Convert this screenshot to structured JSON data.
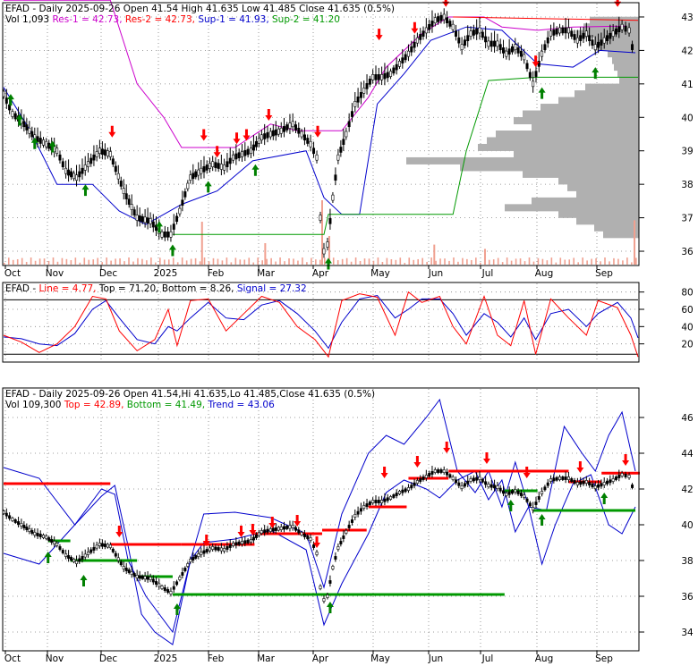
{
  "symbol": "EFAD",
  "colors": {
    "background": "#ffffff",
    "frame": "#000000",
    "grid": "#808080",
    "candle": "#000000",
    "up_arrow": "#008000",
    "down_arrow": "#ff0000",
    "volume": "#f0a090",
    "resistance": "#cc00cc",
    "support": "#0000cc",
    "support2": "#009900",
    "res_line": "#ff0000",
    "volume_profile": "#b0b0b0",
    "stoch_line": "#ff0000",
    "stoch_signal": "#0000cc",
    "bounds": "#000000",
    "trend_top": "#ff0000",
    "trend_bottom": "#009900",
    "envelope": "#0000cc"
  },
  "chart_data": [
    {
      "type": "candlestick",
      "panel": "price-sr",
      "title_parts": [
        {
          "text": "EFAD - Daily 2025-09-26 Open 41.54  High 41.635  Low 41.485  Close 41.635 (0.5%)",
          "color": "#000000"
        }
      ],
      "legend_parts": [
        {
          "text": "Vol 1,093 ",
          "color": "#000000"
        },
        {
          "text": "Res-1 = 42.73, ",
          "color": "#cc00cc"
        },
        {
          "text": "Res-2 = 42.73, ",
          "color": "#ff0000"
        },
        {
          "text": "Sup-1 = 41.93, ",
          "color": "#0000cc"
        },
        {
          "text": "Sup-2 = 41.20",
          "color": "#009900"
        }
      ],
      "ylim": [
        35.6,
        43.4
      ],
      "y_ticks": [
        "36",
        "37",
        "38",
        "39",
        "40",
        "41",
        "42",
        "43"
      ],
      "x_ticks": [
        "Oct",
        "Nov",
        "Dec",
        "2025",
        "Feb",
        "Mar",
        "Apr",
        "May",
        "Jun",
        "Jul",
        "Aug",
        "Sep"
      ]
    },
    {
      "type": "line",
      "panel": "stochastic",
      "legend_parts": [
        {
          "text": "EFAD - ",
          "color": "#000000"
        },
        {
          "text": "Line = 4.77, ",
          "color": "#ff0000"
        },
        {
          "text": "Top = 71.20, ",
          "color": "#000000"
        },
        {
          "text": "Bottom = 8.26, ",
          "color": "#000000"
        },
        {
          "text": "Signal = 27.32",
          "color": "#0000cc"
        }
      ],
      "ylim": [
        0,
        90
      ],
      "y_ticks": [
        "20",
        "40",
        "60",
        "80"
      ]
    },
    {
      "type": "candlestick",
      "panel": "price-trend",
      "title_parts": [
        {
          "text": "EFAD - Daily 2025-09-26 Open 41.54,Hi 41.635,Lo 41.485,Close 41.635 (0.5%)",
          "color": "#000000"
        }
      ],
      "legend_parts": [
        {
          "text": "Vol 109,300 ",
          "color": "#000000"
        },
        {
          "text": "Top = 42.89, ",
          "color": "#ff0000"
        },
        {
          "text": "Bottom = 41.49, ",
          "color": "#009900"
        },
        {
          "text": "Trend = 43.06",
          "color": "#0000cc"
        }
      ],
      "ylim": [
        33.0,
        47.6
      ],
      "y_ticks": [
        "34",
        "36",
        "38",
        "40",
        "42",
        "44",
        "46"
      ],
      "x_ticks": [
        "Oct",
        "Nov",
        "Dec",
        "2025",
        "Feb",
        "Mar",
        "Apr",
        "May",
        "Jun",
        "Jul",
        "Aug",
        "Sep"
      ]
    }
  ],
  "price_series": [
    [
      0,
      40.7
    ],
    [
      10,
      40.1
    ],
    [
      20,
      39.9
    ],
    [
      35,
      39.4
    ],
    [
      48,
      39.2
    ],
    [
      60,
      39.0
    ],
    [
      70,
      38.4
    ],
    [
      82,
      38.2
    ],
    [
      95,
      38.6
    ],
    [
      108,
      39.0
    ],
    [
      120,
      38.9
    ],
    [
      135,
      37.8
    ],
    [
      150,
      37.0
    ],
    [
      165,
      36.9
    ],
    [
      178,
      36.5
    ],
    [
      188,
      36.5
    ],
    [
      198,
      37.2
    ],
    [
      210,
      38.2
    ],
    [
      222,
      38.4
    ],
    [
      235,
      38.6
    ],
    [
      248,
      38.5
    ],
    [
      258,
      38.8
    ],
    [
      268,
      38.9
    ],
    [
      278,
      39.0
    ],
    [
      290,
      39.4
    ],
    [
      300,
      39.5
    ],
    [
      312,
      39.6
    ],
    [
      325,
      39.8
    ],
    [
      335,
      39.5
    ],
    [
      345,
      39.2
    ],
    [
      352,
      38.8
    ],
    [
      356,
      37.0
    ],
    [
      360,
      36.0
    ],
    [
      364,
      36.2
    ],
    [
      370,
      37.6
    ],
    [
      376,
      38.8
    ],
    [
      385,
      39.5
    ],
    [
      395,
      40.4
    ],
    [
      405,
      40.8
    ],
    [
      415,
      41.2
    ],
    [
      425,
      41.2
    ],
    [
      435,
      41.3
    ],
    [
      445,
      41.6
    ],
    [
      455,
      41.9
    ],
    [
      465,
      42.3
    ],
    [
      475,
      42.6
    ],
    [
      485,
      42.9
    ],
    [
      495,
      43.0
    ],
    [
      505,
      42.7
    ],
    [
      515,
      42.1
    ],
    [
      525,
      42.5
    ],
    [
      535,
      42.6
    ],
    [
      545,
      42.2
    ],
    [
      555,
      42.2
    ],
    [
      565,
      41.9
    ],
    [
      575,
      42.1
    ],
    [
      585,
      41.8
    ],
    [
      595,
      41.0
    ],
    [
      605,
      41.9
    ],
    [
      615,
      42.5
    ],
    [
      625,
      42.6
    ],
    [
      635,
      42.6
    ],
    [
      645,
      42.3
    ],
    [
      655,
      42.5
    ],
    [
      665,
      42.1
    ],
    [
      675,
      42.3
    ],
    [
      685,
      42.5
    ],
    [
      695,
      42.7
    ],
    [
      703,
      42.6
    ],
    [
      710,
      41.6
    ]
  ],
  "volume_bars": [
    [
      222,
      0.6
    ],
    [
      293,
      0.3
    ],
    [
      357,
      0.9
    ],
    [
      365,
      0.4
    ],
    [
      483,
      0.28
    ],
    [
      540,
      0.22
    ],
    [
      708,
      0.62
    ]
  ],
  "volume_profile": [
    [
      42.9,
      55
    ],
    [
      42.7,
      62
    ],
    [
      42.5,
      70
    ],
    [
      42.3,
      50
    ],
    [
      42.1,
      48
    ],
    [
      41.9,
      35
    ],
    [
      41.7,
      30
    ],
    [
      41.5,
      28
    ],
    [
      41.3,
      24
    ],
    [
      41.1,
      22
    ],
    [
      40.9,
      60
    ],
    [
      40.7,
      72
    ],
    [
      40.5,
      90
    ],
    [
      40.3,
      110
    ],
    [
      40.1,
      130
    ],
    [
      39.9,
      140
    ],
    [
      39.7,
      120
    ],
    [
      39.5,
      160
    ],
    [
      39.3,
      170
    ],
    [
      39.1,
      180
    ],
    [
      38.9,
      140
    ],
    [
      38.7,
      260
    ],
    [
      38.5,
      200
    ],
    [
      38.3,
      130
    ],
    [
      38.1,
      90
    ],
    [
      37.9,
      80
    ],
    [
      37.7,
      70
    ],
    [
      37.5,
      120
    ],
    [
      37.3,
      150
    ],
    [
      37.1,
      90
    ],
    [
      36.9,
      70
    ],
    [
      36.7,
      50
    ],
    [
      36.5,
      40
    ]
  ],
  "res1_line": [
    [
      0,
      43.5
    ],
    [
      120,
      43.5
    ],
    [
      150,
      41.0
    ],
    [
      180,
      40.0
    ],
    [
      200,
      39.1
    ],
    [
      260,
      39.1
    ],
    [
      300,
      39.8
    ],
    [
      330,
      39.6
    ],
    [
      380,
      39.6
    ],
    [
      410,
      40.6
    ],
    [
      430,
      41.5
    ],
    [
      470,
      42.5
    ],
    [
      500,
      43.0
    ],
    [
      540,
      43.0
    ],
    [
      560,
      42.7
    ],
    [
      600,
      42.6
    ],
    [
      640,
      42.7
    ],
    [
      700,
      42.73
    ]
  ],
  "sup1_line": [
    [
      0,
      40.9
    ],
    [
      30,
      39.6
    ],
    [
      60,
      38.0
    ],
    [
      100,
      38.0
    ],
    [
      130,
      37.2
    ],
    [
      160,
      36.8
    ],
    [
      200,
      37.4
    ],
    [
      240,
      37.8
    ],
    [
      280,
      38.7
    ],
    [
      340,
      39.0
    ],
    [
      360,
      37.6
    ],
    [
      380,
      37.1
    ],
    [
      400,
      37.1
    ],
    [
      420,
      40.4
    ],
    [
      450,
      41.3
    ],
    [
      480,
      42.3
    ],
    [
      520,
      42.7
    ],
    [
      560,
      42.6
    ],
    [
      600,
      41.6
    ],
    [
      640,
      41.5
    ],
    [
      670,
      42.0
    ],
    [
      710,
      41.93
    ]
  ],
  "sup2_line": [
    [
      190,
      36.5
    ],
    [
      360,
      36.5
    ],
    [
      365,
      37.1
    ],
    [
      505,
      37.1
    ],
    [
      520,
      39.0
    ],
    [
      545,
      41.1
    ],
    [
      600,
      41.2
    ],
    [
      713,
      41.2
    ]
  ],
  "res2_line": [
    [
      505,
      43.0
    ],
    [
      713,
      42.9
    ]
  ],
  "up_arrows_top": [
    [
      8,
      40.7
    ],
    [
      18,
      40.1
    ],
    [
      35,
      39.4
    ],
    [
      55,
      39.3
    ],
    [
      92,
      38.0
    ],
    [
      175,
      36.9
    ],
    [
      190,
      36.2
    ],
    [
      230,
      38.1
    ],
    [
      283,
      38.6
    ],
    [
      365,
      35.8
    ],
    [
      605,
      40.9
    ],
    [
      665,
      41.5
    ]
  ],
  "down_arrows_top": [
    [
      122,
      39.4
    ],
    [
      225,
      39.3
    ],
    [
      240,
      38.8
    ],
    [
      262,
      39.2
    ],
    [
      273,
      39.3
    ],
    [
      298,
      39.9
    ],
    [
      353,
      39.4
    ],
    [
      422,
      42.3
    ],
    [
      462,
      42.5
    ],
    [
      497,
      43.3
    ],
    [
      598,
      41.5
    ],
    [
      690,
      43.3
    ]
  ],
  "stoch_line": [
    [
      0,
      30
    ],
    [
      20,
      22
    ],
    [
      40,
      10
    ],
    [
      60,
      20
    ],
    [
      80,
      40
    ],
    [
      100,
      75
    ],
    [
      115,
      72
    ],
    [
      130,
      35
    ],
    [
      150,
      12
    ],
    [
      170,
      25
    ],
    [
      185,
      60
    ],
    [
      195,
      18
    ],
    [
      210,
      70
    ],
    [
      230,
      72
    ],
    [
      250,
      35
    ],
    [
      270,
      55
    ],
    [
      290,
      75
    ],
    [
      310,
      68
    ],
    [
      330,
      40
    ],
    [
      350,
      25
    ],
    [
      365,
      5
    ],
    [
      380,
      70
    ],
    [
      400,
      78
    ],
    [
      420,
      74
    ],
    [
      440,
      30
    ],
    [
      455,
      80
    ],
    [
      470,
      68
    ],
    [
      490,
      75
    ],
    [
      505,
      40
    ],
    [
      520,
      20
    ],
    [
      540,
      75
    ],
    [
      555,
      30
    ],
    [
      570,
      18
    ],
    [
      585,
      70
    ],
    [
      598,
      8
    ],
    [
      615,
      72
    ],
    [
      635,
      50
    ],
    [
      655,
      30
    ],
    [
      668,
      70
    ],
    [
      690,
      62
    ],
    [
      705,
      30
    ],
    [
      713,
      5
    ]
  ],
  "stoch_signal": [
    [
      0,
      28
    ],
    [
      20,
      26
    ],
    [
      40,
      20
    ],
    [
      60,
      18
    ],
    [
      80,
      32
    ],
    [
      100,
      60
    ],
    [
      115,
      70
    ],
    [
      130,
      50
    ],
    [
      150,
      25
    ],
    [
      170,
      20
    ],
    [
      185,
      40
    ],
    [
      195,
      35
    ],
    [
      210,
      50
    ],
    [
      230,
      68
    ],
    [
      250,
      50
    ],
    [
      270,
      48
    ],
    [
      290,
      65
    ],
    [
      310,
      70
    ],
    [
      330,
      55
    ],
    [
      350,
      35
    ],
    [
      365,
      15
    ],
    [
      380,
      45
    ],
    [
      400,
      72
    ],
    [
      420,
      76
    ],
    [
      440,
      50
    ],
    [
      455,
      60
    ],
    [
      470,
      72
    ],
    [
      490,
      72
    ],
    [
      505,
      55
    ],
    [
      520,
      30
    ],
    [
      540,
      55
    ],
    [
      555,
      45
    ],
    [
      570,
      28
    ],
    [
      585,
      50
    ],
    [
      598,
      25
    ],
    [
      615,
      55
    ],
    [
      635,
      60
    ],
    [
      655,
      40
    ],
    [
      668,
      55
    ],
    [
      690,
      68
    ],
    [
      705,
      50
    ],
    [
      713,
      27
    ]
  ],
  "stoch_top_line": [
    [
      0,
      71
    ],
    [
      713,
      71
    ]
  ],
  "stoch_bottom_line": [
    [
      0,
      8
    ],
    [
      713,
      8
    ]
  ],
  "trend_series": [
    [
      0,
      40.7
    ],
    [
      10,
      40.3
    ],
    [
      20,
      40.0
    ],
    [
      35,
      39.5
    ],
    [
      48,
      39.3
    ],
    [
      60,
      38.9
    ],
    [
      70,
      38.3
    ],
    [
      82,
      37.9
    ],
    [
      95,
      38.4
    ],
    [
      108,
      38.9
    ],
    [
      120,
      38.8
    ],
    [
      135,
      37.6
    ],
    [
      150,
      37.1
    ],
    [
      165,
      37.0
    ],
    [
      178,
      36.5
    ],
    [
      188,
      36.2
    ],
    [
      198,
      37.0
    ],
    [
      210,
      38.0
    ],
    [
      222,
      38.4
    ],
    [
      235,
      38.7
    ],
    [
      248,
      38.6
    ],
    [
      258,
      38.9
    ],
    [
      268,
      39.0
    ],
    [
      278,
      39.1
    ],
    [
      290,
      39.6
    ],
    [
      300,
      39.7
    ],
    [
      312,
      39.8
    ],
    [
      325,
      39.9
    ],
    [
      335,
      39.5
    ],
    [
      345,
      39.2
    ],
    [
      352,
      38.4
    ],
    [
      356,
      36.5
    ],
    [
      360,
      35.8
    ],
    [
      364,
      36.0
    ],
    [
      370,
      37.6
    ],
    [
      376,
      38.7
    ],
    [
      385,
      39.6
    ],
    [
      395,
      40.5
    ],
    [
      405,
      41.0
    ],
    [
      415,
      41.3
    ],
    [
      425,
      41.3
    ],
    [
      435,
      41.5
    ],
    [
      445,
      41.8
    ],
    [
      455,
      42.0
    ],
    [
      465,
      42.4
    ],
    [
      475,
      42.7
    ],
    [
      485,
      43.0
    ],
    [
      495,
      43.0
    ],
    [
      505,
      42.6
    ],
    [
      515,
      42.1
    ],
    [
      525,
      42.5
    ],
    [
      535,
      42.6
    ],
    [
      545,
      42.2
    ],
    [
      555,
      42.1
    ],
    [
      565,
      41.7
    ],
    [
      575,
      41.9
    ],
    [
      585,
      41.6
    ],
    [
      595,
      40.9
    ],
    [
      605,
      41.8
    ],
    [
      615,
      42.5
    ],
    [
      625,
      42.6
    ],
    [
      635,
      42.6
    ],
    [
      645,
      42.3
    ],
    [
      655,
      42.4
    ],
    [
      665,
      42.1
    ],
    [
      675,
      42.3
    ],
    [
      685,
      42.5
    ],
    [
      695,
      42.8
    ],
    [
      703,
      42.7
    ],
    [
      710,
      41.6
    ]
  ],
  "envelope_upper": [
    [
      0,
      43.2
    ],
    [
      40,
      42.6
    ],
    [
      80,
      40.0
    ],
    [
      110,
      42.0
    ],
    [
      125,
      41.7
    ],
    [
      140,
      38.0
    ],
    [
      160,
      36.0
    ],
    [
      190,
      34.0
    ],
    [
      210,
      38.0
    ],
    [
      225,
      40.6
    ],
    [
      260,
      40.7
    ],
    [
      300,
      40.4
    ],
    [
      340,
      39.5
    ],
    [
      360,
      36.5
    ],
    [
      380,
      40.6
    ],
    [
      410,
      44.0
    ],
    [
      430,
      45.0
    ],
    [
      450,
      44.5
    ],
    [
      475,
      46.0
    ],
    [
      490,
      47.0
    ],
    [
      510,
      43.0
    ],
    [
      530,
      41.8
    ],
    [
      545,
      43.0
    ],
    [
      560,
      41.0
    ],
    [
      575,
      43.5
    ],
    [
      590,
      41.0
    ],
    [
      610,
      40.8
    ],
    [
      630,
      45.5
    ],
    [
      650,
      44.0
    ],
    [
      665,
      43.0
    ],
    [
      680,
      45.0
    ],
    [
      695,
      46.3
    ],
    [
      710,
      43.0
    ]
  ],
  "envelope_lower": [
    [
      0,
      38.4
    ],
    [
      40,
      37.8
    ],
    [
      80,
      40.0
    ],
    [
      110,
      41.6
    ],
    [
      125,
      42.2
    ],
    [
      140,
      38.8
    ],
    [
      155,
      35.0
    ],
    [
      170,
      34.0
    ],
    [
      190,
      33.3
    ],
    [
      210,
      38.0
    ],
    [
      225,
      39.0
    ],
    [
      260,
      39.2
    ],
    [
      300,
      39.7
    ],
    [
      340,
      38.6
    ],
    [
      360,
      34.4
    ],
    [
      380,
      36.7
    ],
    [
      410,
      39.5
    ],
    [
      430,
      41.8
    ],
    [
      450,
      42.5
    ],
    [
      475,
      42.0
    ],
    [
      490,
      41.5
    ],
    [
      510,
      42.5
    ],
    [
      530,
      43.0
    ],
    [
      545,
      41.4
    ],
    [
      560,
      42.5
    ],
    [
      575,
      39.6
    ],
    [
      590,
      41.0
    ],
    [
      605,
      37.8
    ],
    [
      620,
      40.0
    ],
    [
      640,
      42.3
    ],
    [
      660,
      42.8
    ],
    [
      680,
      40.0
    ],
    [
      695,
      39.5
    ],
    [
      710,
      41.0
    ]
  ],
  "top_segments": [
    [
      0,
      120,
      42.3
    ],
    [
      120,
      200,
      38.9
    ],
    [
      200,
      282,
      38.9
    ],
    [
      282,
      358,
      39.5
    ],
    [
      358,
      408,
      39.7
    ],
    [
      410,
      453,
      41.0
    ],
    [
      455,
      500,
      42.6
    ],
    [
      500,
      635,
      43.0
    ],
    [
      575,
      635,
      43.0
    ],
    [
      635,
      672,
      42.4
    ],
    [
      672,
      715,
      42.89
    ]
  ],
  "bottom_segments": [
    [
      50,
      75,
      39.1
    ],
    [
      75,
      150,
      38.0
    ],
    [
      150,
      190,
      37.1
    ],
    [
      190,
      345,
      36.1
    ],
    [
      345,
      563,
      36.1
    ],
    [
      563,
      600,
      41.9
    ],
    [
      595,
      710,
      40.8
    ]
  ],
  "up_arrows_bottom": [
    [
      50,
      38.5
    ],
    [
      90,
      37.2
    ],
    [
      195,
      35.6
    ],
    [
      367,
      35.7
    ],
    [
      570,
      41.4
    ],
    [
      605,
      40.6
    ],
    [
      675,
      41.8
    ]
  ],
  "down_arrows_bottom": [
    [
      130,
      39.3
    ],
    [
      228,
      38.8
    ],
    [
      267,
      39.3
    ],
    [
      280,
      39.4
    ],
    [
      302,
      39.8
    ],
    [
      330,
      39.9
    ],
    [
      352,
      38.7
    ],
    [
      428,
      42.6
    ],
    [
      465,
      43.2
    ],
    [
      498,
      44.0
    ],
    [
      543,
      43.4
    ],
    [
      588,
      42.6
    ],
    [
      648,
      42.9
    ],
    [
      699,
      43.3
    ]
  ]
}
